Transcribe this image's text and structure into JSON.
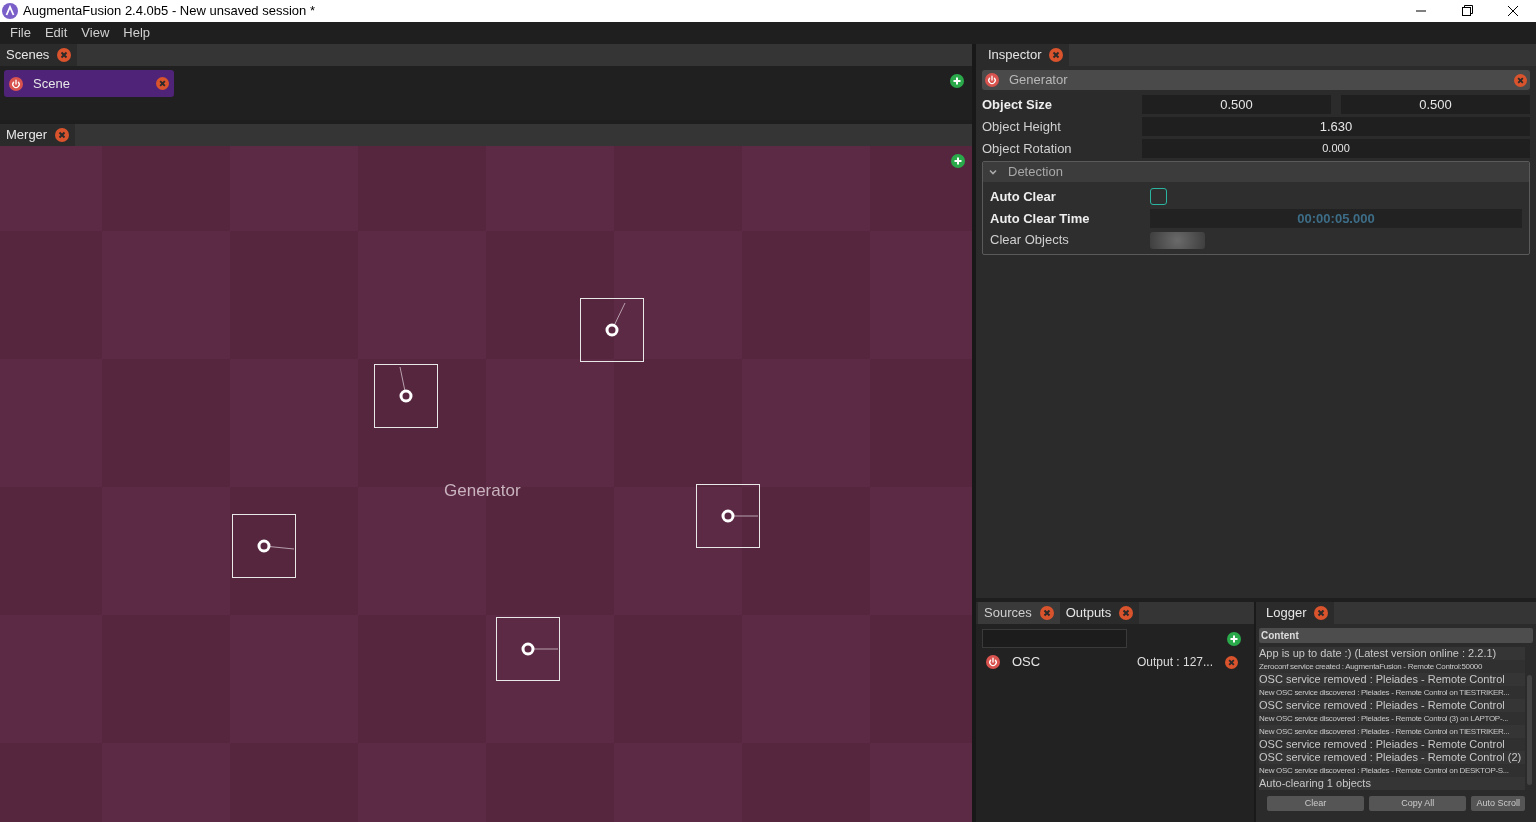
{
  "window": {
    "title": "AugmentaFusion 2.4.0b5 - New unsaved session *"
  },
  "menu": [
    "File",
    "Edit",
    "View",
    "Help"
  ],
  "scenes_panel": {
    "title": "Scenes",
    "items": [
      {
        "label": "Scene",
        "selected": true
      }
    ]
  },
  "merger_panel": {
    "title": "Merger",
    "node_label": "Generator"
  },
  "inspector": {
    "title": "Inspector",
    "header": "Generator",
    "rows": [
      {
        "label": "Object Size",
        "bold": true,
        "values": [
          "0.500",
          "0.500"
        ]
      },
      {
        "label": "Object Height",
        "bold": false,
        "values": [
          "1.630"
        ]
      },
      {
        "label": "Object Rotation",
        "bold": false,
        "values": [
          "0.000"
        ]
      }
    ],
    "detection": {
      "title": "Detection",
      "expanded": true,
      "auto_clear": {
        "label": "Auto Clear",
        "checked": false
      },
      "auto_clear_time": {
        "label": "Auto Clear Time",
        "value": "00:00:05.000"
      },
      "clear_objects": {
        "label": "Clear Objects"
      }
    }
  },
  "io_panel": {
    "tabs": [
      {
        "label": "Sources",
        "selected": false
      },
      {
        "label": "Outputs",
        "selected": true
      }
    ],
    "items": [
      {
        "name": "OSC",
        "detail": "Output : 127..."
      }
    ]
  },
  "logger": {
    "title": "Logger",
    "column": "Content",
    "lines": [
      {
        "kind": "large",
        "text": "App is up to date :) (Latest version online : 2.2.1)"
      },
      {
        "kind": "small",
        "text": "Zeroconf service created : AugmentaFusion - Remote Control:50000"
      },
      {
        "kind": "large",
        "text": "OSC service removed : Pleiades - Remote Control"
      },
      {
        "kind": "small",
        "text": "New OSC service discovered : Pleiades - Remote Control on TIESTRIKER..."
      },
      {
        "kind": "large",
        "text": "OSC service removed : Pleiades - Remote Control"
      },
      {
        "kind": "small",
        "text": "New OSC service discovered : Pleiades - Remote Control (3) on LAPTOP-..."
      },
      {
        "kind": "small",
        "text": "New OSC service discovered : Pleiades - Remote Control on TIESTRIKER..."
      },
      {
        "kind": "large",
        "text": "OSC service removed : Pleiades - Remote Control"
      },
      {
        "kind": "large",
        "text": "OSC service removed : Pleiades - Remote Control (2)"
      },
      {
        "kind": "small",
        "text": "New OSC service discovered : Pleiades - Remote Control on DESKTOP-S..."
      },
      {
        "kind": "large",
        "text": "Auto-clearing 1 objects"
      }
    ],
    "buttons": [
      "Clear",
      "Copy All",
      "Auto Scroll"
    ]
  }
}
